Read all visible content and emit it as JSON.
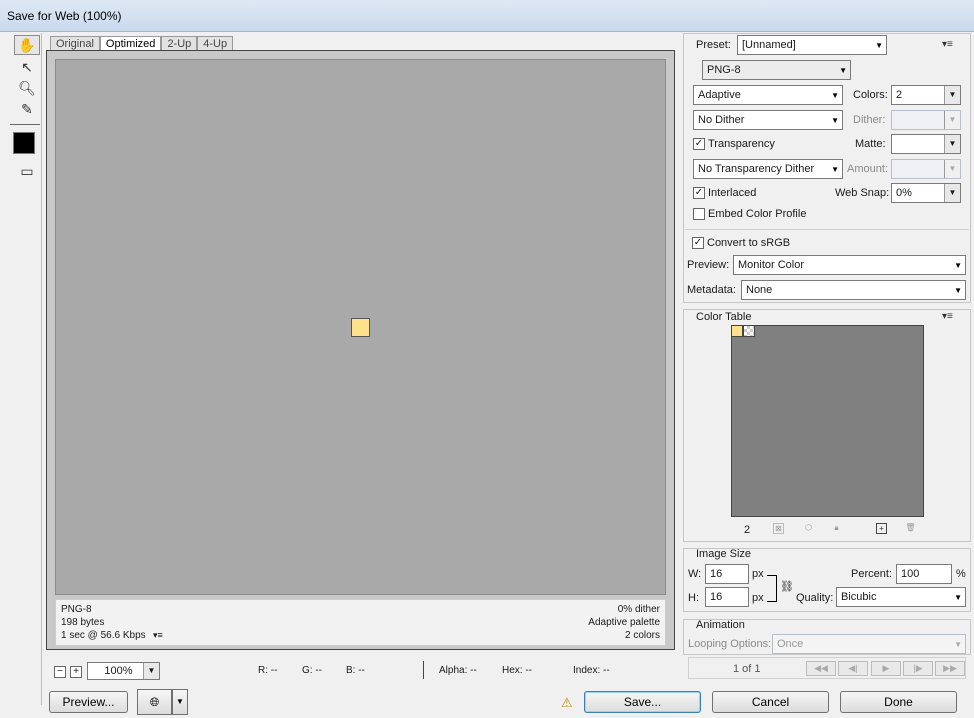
{
  "window": {
    "title": "Save for Web (100%)"
  },
  "tabs": [
    "Original",
    "Optimized",
    "2-Up",
    "4-Up"
  ],
  "info": {
    "format": "PNG-8",
    "size": "198 bytes",
    "speed": "1 sec @ 56.6 Kbps",
    "dither": "0% dither",
    "palette": "Adaptive palette",
    "colors": "2 colors"
  },
  "zoom": {
    "value": "100%",
    "minus": "−",
    "plus": "+"
  },
  "readout": {
    "r": "R: --",
    "g": "G: --",
    "b": "B: --",
    "alpha": "Alpha: --",
    "hex": "Hex: --",
    "index": "Index: --"
  },
  "settings": {
    "preset_label": "Preset:",
    "preset_value": "[Unnamed]",
    "format_value": "PNG-8",
    "reduction_value": "Adaptive",
    "colors_label": "Colors:",
    "colors_value": "2",
    "dither_value": "No Dither",
    "dither_label": "Dither:",
    "transparency_label": "Transparency",
    "transparency_checked": true,
    "matte_label": "Matte:",
    "trans_dither_value": "No Transparency Dither",
    "amount_label": "Amount:",
    "interlaced_label": "Interlaced",
    "interlaced_checked": true,
    "websnap_label": "Web Snap:",
    "websnap_value": "0%",
    "embed_label": "Embed Color Profile",
    "embed_checked": false,
    "srgb_label": "Convert to sRGB",
    "srgb_checked": true,
    "preview_label": "Preview:",
    "preview_value": "Monitor Color",
    "metadata_label": "Metadata:",
    "metadata_value": "None"
  },
  "color_table": {
    "title": "Color Table",
    "count": "2",
    "colors": [
      "#ffe08c",
      "transparent"
    ]
  },
  "image_size": {
    "title": "Image Size",
    "w_label": "W:",
    "w_value": "16",
    "h_label": "H:",
    "h_value": "16",
    "unit": "px",
    "percent_label": "Percent:",
    "percent_value": "100",
    "percent_unit": "%",
    "quality_label": "Quality:",
    "quality_value": "Bicubic"
  },
  "animation": {
    "title": "Animation",
    "looping_label": "Looping Options:",
    "looping_value": "Once",
    "frame": "1 of 1"
  },
  "buttons": {
    "preview": "Preview...",
    "save": "Save...",
    "cancel": "Cancel",
    "done": "Done"
  },
  "accent": {
    "matte_swatch": "#ffe08c",
    "default_button": "#3c7fb1"
  },
  "icons": [
    "hand-icon",
    "slice-select-icon",
    "zoom-icon",
    "eyedropper-icon",
    "eyedropper-color-swatch",
    "toggle-slices-icon",
    "warning-icon",
    "browser-preview-icon",
    "panel-menu-icon",
    "link-icon"
  ]
}
